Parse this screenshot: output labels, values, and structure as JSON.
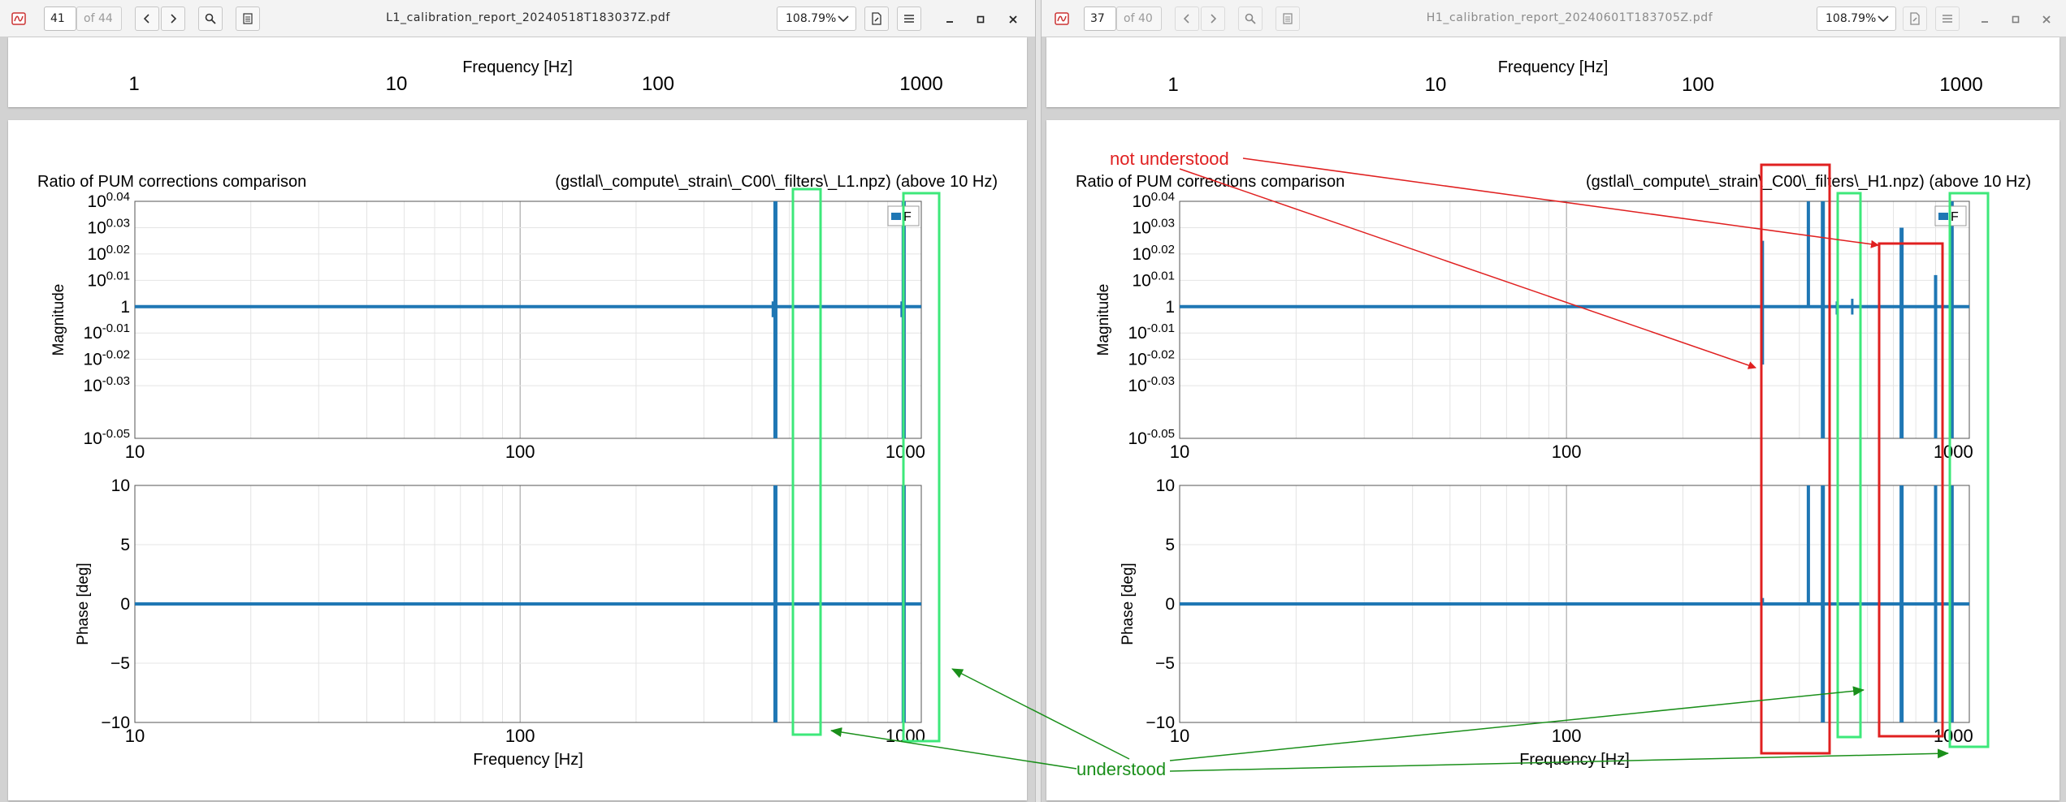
{
  "left_viewer": {
    "toolbar": {
      "page_number": "41",
      "page_total": "of 44",
      "filename": "L1_calibration_report_20240518T183037Z.pdf",
      "zoom": "108.79%"
    },
    "top_page": {
      "x_ticks": [
        "1",
        "10",
        "100",
        "1000"
      ],
      "xlabel": "Frequency [Hz]"
    },
    "figure": {
      "title_left": "Ratio of PUM corrections comparison",
      "title_right": "(gstlal\\_compute\\_strain\\_C00\\_filters\\_L1.npz) (above 10 Hz)",
      "legend_label": "F",
      "mag_ylabel": "Magnitude",
      "phase_ylabel": "Phase [deg]",
      "xlabel": "Frequency [Hz]",
      "x_ticks": [
        "10",
        "100",
        "1000"
      ],
      "mag_y_ticks": [
        "10^0.04",
        "10^0.03",
        "10^0.02",
        "10^0.01",
        "1",
        "10^-0.01",
        "10^-0.02",
        "10^-0.03",
        "10^-0.05"
      ],
      "phase_y_ticks": [
        "10",
        "5",
        "0",
        "−5",
        "−10"
      ]
    }
  },
  "right_viewer": {
    "toolbar": {
      "page_number": "37",
      "page_total": "of 40",
      "filename": "H1_calibration_report_20240601T183705Z.pdf",
      "zoom": "108.79%"
    },
    "top_page": {
      "x_ticks": [
        "1",
        "10",
        "100",
        "1000"
      ],
      "xlabel": "Frequency [Hz]"
    },
    "figure": {
      "title_left": "Ratio of PUM corrections comparison",
      "title_right": "(gstlal\\_compute\\_strain\\_C00\\_filters\\_H1.npz) (above 10 Hz)",
      "legend_label": "F",
      "mag_ylabel": "Magnitude",
      "phase_ylabel": "Phase [deg]",
      "xlabel": "Frequency [Hz]",
      "x_ticks": [
        "10",
        "100",
        "1000"
      ],
      "mag_y_ticks": [
        "10^0.04",
        "10^0.03",
        "10^0.02",
        "10^0.01",
        "1",
        "10^-0.01",
        "10^-0.02",
        "10^-0.03",
        "10^-0.05"
      ],
      "phase_y_ticks": [
        "10",
        "5",
        "0",
        "−5",
        "−10"
      ]
    }
  },
  "annotations": {
    "not_understood": "not understood",
    "understood": "understood",
    "red_color": "#e02020",
    "green_color": "#1a8f1a",
    "box_green": "#3de87a"
  },
  "chart_data": [
    {
      "type": "line",
      "xscale": "log",
      "xlim": [
        10,
        1100
      ],
      "xlabel": "Frequency [Hz]",
      "panels": [
        {
          "ylabel": "Magnitude",
          "yscale": "log10-exponent",
          "ylim_exponent": [
            -0.05,
            0.04
          ],
          "baseline": 1
        },
        {
          "ylabel": "Phase [deg]",
          "ylim": [
            -10,
            10
          ],
          "baseline": 0
        }
      ],
      "series": [
        {
          "name": "F",
          "color": "#1f77b4"
        }
      ],
      "features_hz": [
        460,
        990
      ],
      "grid": true,
      "legend": "top-right"
    },
    {
      "type": "line",
      "xscale": "log",
      "xlim": [
        10,
        1100
      ],
      "xlabel": "Frequency [Hz]",
      "panels": [
        {
          "ylabel": "Magnitude",
          "yscale": "log10-exponent",
          "ylim_exponent": [
            -0.05,
            0.04
          ],
          "baseline": 1
        },
        {
          "ylabel": "Phase [deg]",
          "ylim": [
            -10,
            10
          ],
          "baseline": 0
        }
      ],
      "series": [
        {
          "name": "F",
          "color": "#1f77b4"
        }
      ],
      "features_hz": [
        320,
        420,
        460,
        510,
        735,
        890,
        990
      ],
      "grid": true,
      "legend": "top-right"
    }
  ]
}
